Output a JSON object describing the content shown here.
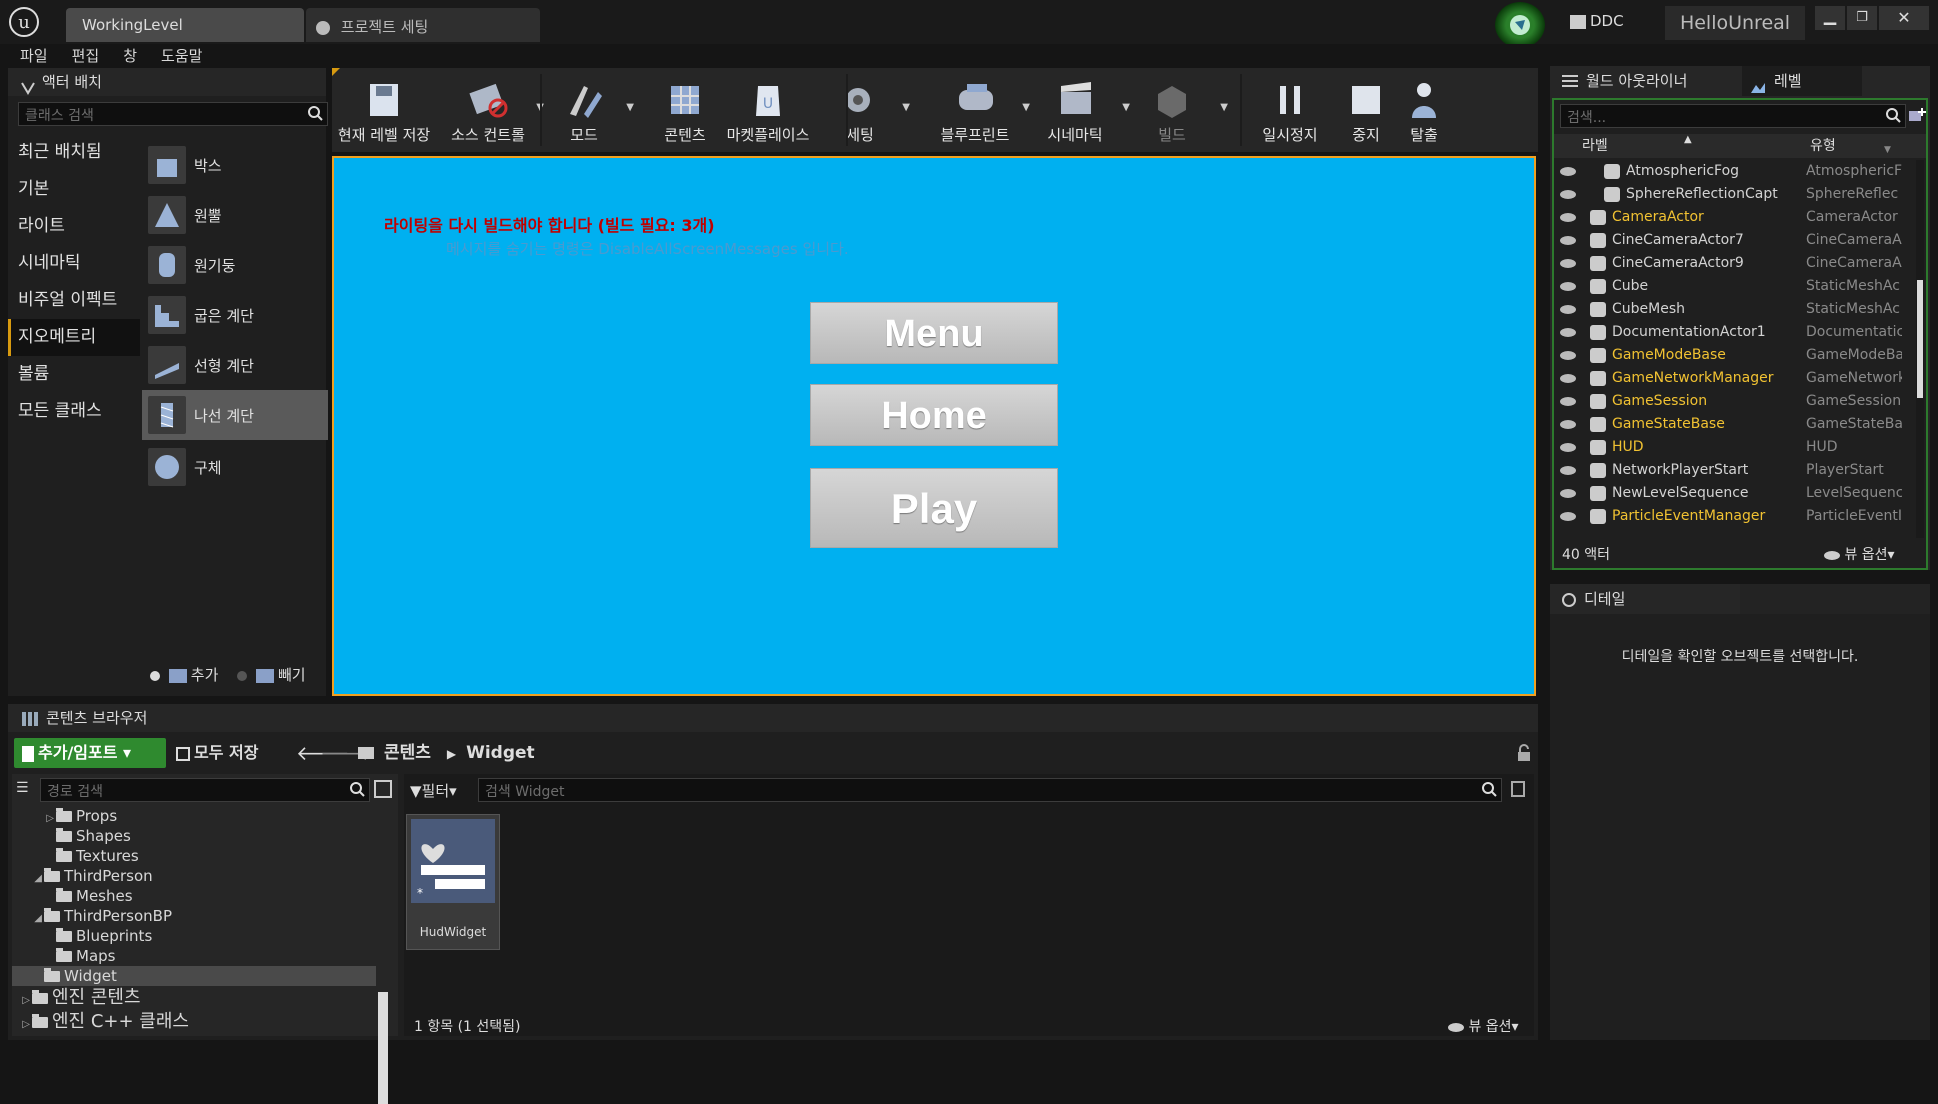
{
  "titlebar": {
    "tabs": [
      "WorkingLevel",
      "프로젝트 세팅"
    ],
    "ddc": "DDC",
    "project": "HelloUnreal"
  },
  "menubar": [
    "파일",
    "편집",
    "창",
    "도움말"
  ],
  "place_panel": {
    "tab": "액터 배치",
    "search_placeholder": "클래스 검색",
    "categories": [
      "최근 배치됨",
      "기본",
      "라이트",
      "시네마틱",
      "비주얼 이펙트",
      "지오메트리",
      "볼륨",
      "모든 클래스"
    ],
    "selected_category": "지오메트리",
    "items": [
      "박스",
      "원뿔",
      "원기둥",
      "굽은 계단",
      "선형 계단",
      "나선 계단",
      "구체"
    ],
    "selected_item": "나선 계단",
    "add_label": "추가",
    "subtract_label": "빼기"
  },
  "toolbar": {
    "buttons": [
      "현재 레벨 저장",
      "소스 컨트롤",
      "모드",
      "콘텐츠",
      "마켓플레이스",
      "세팅",
      "블루프린트",
      "시네마틱",
      "빌드",
      "일시정지",
      "중지",
      "탈출"
    ]
  },
  "viewport": {
    "warning": "라이팅을 다시 빌드해야 합니다 (빌드 필요: 3개)",
    "hint": "메시지를 숨기는 명령은 DisableAllScreenMessages 입니다.",
    "buttons": [
      "Menu",
      "Home",
      "Play"
    ],
    "colors": {
      "background": "#00b0f0",
      "warning": "#c00000"
    }
  },
  "outliner": {
    "tabs": [
      "월드 아웃라이너",
      "레벨"
    ],
    "search_placeholder": "검색...",
    "col_label": "라벨",
    "col_type": "유형",
    "rows": [
      {
        "name": "AtmosphericFog",
        "type": "AtmosphericF",
        "indent": 1,
        "gold": false,
        "icon": "fog-icon"
      },
      {
        "name": "SphereReflectionCapt",
        "type": "SphereReflec",
        "indent": 1,
        "gold": false,
        "icon": "sphere-capture-icon"
      },
      {
        "name": "CameraActor",
        "type": "CameraActor",
        "indent": 0,
        "gold": true,
        "icon": "camera-icon"
      },
      {
        "name": "CineCameraActor7",
        "type": "CineCameraA",
        "indent": 0,
        "gold": false,
        "icon": "camera-icon"
      },
      {
        "name": "CineCameraActor9",
        "type": "CineCameraA",
        "indent": 0,
        "gold": false,
        "icon": "camera-icon"
      },
      {
        "name": "Cube",
        "type": "StaticMeshAc",
        "indent": 0,
        "gold": false,
        "icon": "mesh-icon"
      },
      {
        "name": "CubeMesh",
        "type": "StaticMeshAc",
        "indent": 0,
        "gold": false,
        "icon": "mesh-icon"
      },
      {
        "name": "DocumentationActor1",
        "type": "Documentatic",
        "indent": 0,
        "gold": false,
        "icon": "doc-icon"
      },
      {
        "name": "GameModeBase",
        "type": "GameModeBa",
        "indent": 0,
        "gold": true,
        "icon": "gamemode-icon"
      },
      {
        "name": "GameNetworkManager",
        "type": "GameNetwork",
        "indent": 0,
        "gold": true,
        "icon": "actor-ball-icon"
      },
      {
        "name": "GameSession",
        "type": "GameSession",
        "indent": 0,
        "gold": true,
        "icon": "actor-ball-icon"
      },
      {
        "name": "GameStateBase",
        "type": "GameStateBa",
        "indent": 0,
        "gold": true,
        "icon": "gamestate-icon"
      },
      {
        "name": "HUD",
        "type": "HUD",
        "indent": 0,
        "gold": true,
        "icon": "hud-icon"
      },
      {
        "name": "NetworkPlayerStart",
        "type": "PlayerStart",
        "indent": 0,
        "gold": false,
        "icon": "player-start-icon"
      },
      {
        "name": "NewLevelSequence",
        "type": "LevelSequenc",
        "indent": 0,
        "gold": false,
        "icon": "sequence-icon"
      },
      {
        "name": "ParticleEventManager",
        "type": "ParticleEventI",
        "indent": 0,
        "gold": true,
        "icon": "actor-ball-icon"
      }
    ],
    "count": "40 액터",
    "view_options": "뷰 옵션"
  },
  "details": {
    "tab": "디테일",
    "empty": "디테일을 확인할 오브젝트를 선택합니다."
  },
  "content_browser": {
    "tab": "콘텐츠 브라우저",
    "add_import": "추가/임포트",
    "save_all": "모두 저장",
    "breadcrumb": [
      "콘텐츠",
      "Widget"
    ],
    "path_search": "경로 검색",
    "filter": "필터",
    "asset_search": "검색 Widget",
    "tree": [
      {
        "label": "Props",
        "depth": 2,
        "arrow": "closed"
      },
      {
        "label": "Shapes",
        "depth": 2,
        "arrow": ""
      },
      {
        "label": "Textures",
        "depth": 2,
        "arrow": ""
      },
      {
        "label": "ThirdPerson",
        "depth": 1,
        "arrow": "open"
      },
      {
        "label": "Meshes",
        "depth": 2,
        "arrow": ""
      },
      {
        "label": "ThirdPersonBP",
        "depth": 1,
        "arrow": "open"
      },
      {
        "label": "Blueprints",
        "depth": 2,
        "arrow": ""
      },
      {
        "label": "Maps",
        "depth": 2,
        "arrow": ""
      },
      {
        "label": "Widget",
        "depth": 1,
        "arrow": "",
        "selected": true
      },
      {
        "label": "엔진 콘텐츠",
        "depth": 0,
        "arrow": "closed",
        "big": true
      },
      {
        "label": "엔진 C++ 클래스",
        "depth": 0,
        "arrow": "closed",
        "big": true
      }
    ],
    "asset": "HudWidget",
    "status": "1 항목 (1 선택됨)",
    "view_options": "뷰 옵션"
  }
}
